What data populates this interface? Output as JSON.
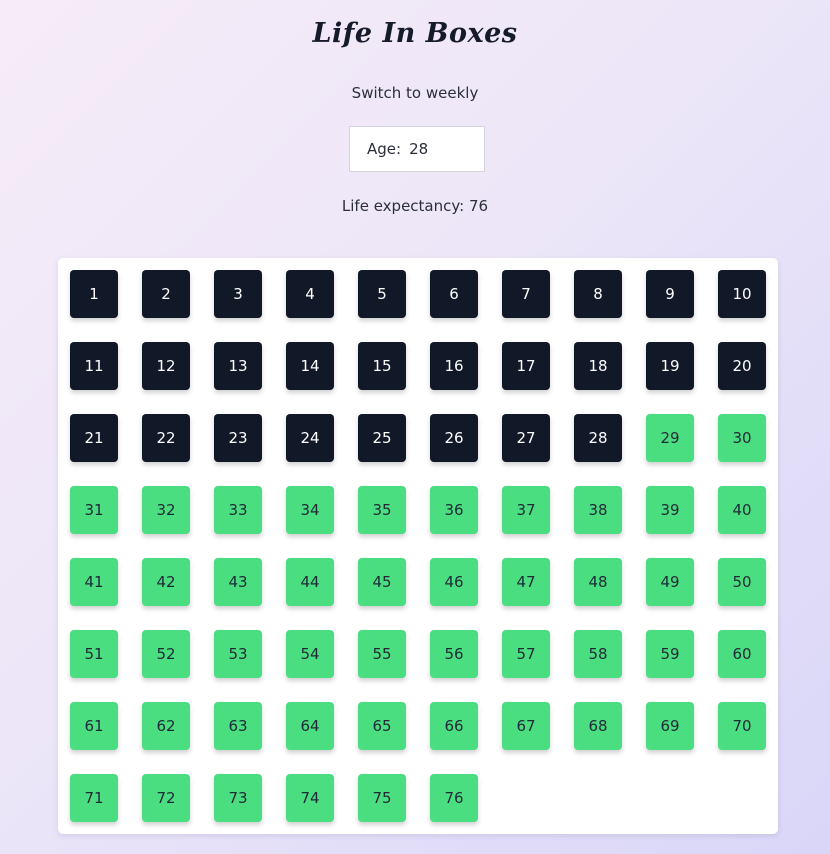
{
  "header": {
    "title": "Life In Boxes",
    "switch_label": "Switch to weekly"
  },
  "age_input": {
    "label": "Age:",
    "value": "28"
  },
  "life_expectancy": {
    "text": "Life expectancy: 76"
  },
  "grid": {
    "age": 28,
    "total": 76,
    "columns": 10,
    "lived_color": "#111827",
    "lived_text_color": "#ffffff",
    "remaining_color": "#4ade80",
    "remaining_text_color": "#1f2937",
    "boxes": [
      "1",
      "2",
      "3",
      "4",
      "5",
      "6",
      "7",
      "8",
      "9",
      "10",
      "11",
      "12",
      "13",
      "14",
      "15",
      "16",
      "17",
      "18",
      "19",
      "20",
      "21",
      "22",
      "23",
      "24",
      "25",
      "26",
      "27",
      "28",
      "29",
      "30",
      "31",
      "32",
      "33",
      "34",
      "35",
      "36",
      "37",
      "38",
      "39",
      "40",
      "41",
      "42",
      "43",
      "44",
      "45",
      "46",
      "47",
      "48",
      "49",
      "50",
      "51",
      "52",
      "53",
      "54",
      "55",
      "56",
      "57",
      "58",
      "59",
      "60",
      "61",
      "62",
      "63",
      "64",
      "65",
      "66",
      "67",
      "68",
      "69",
      "70",
      "71",
      "72",
      "73",
      "74",
      "75",
      "76"
    ]
  }
}
